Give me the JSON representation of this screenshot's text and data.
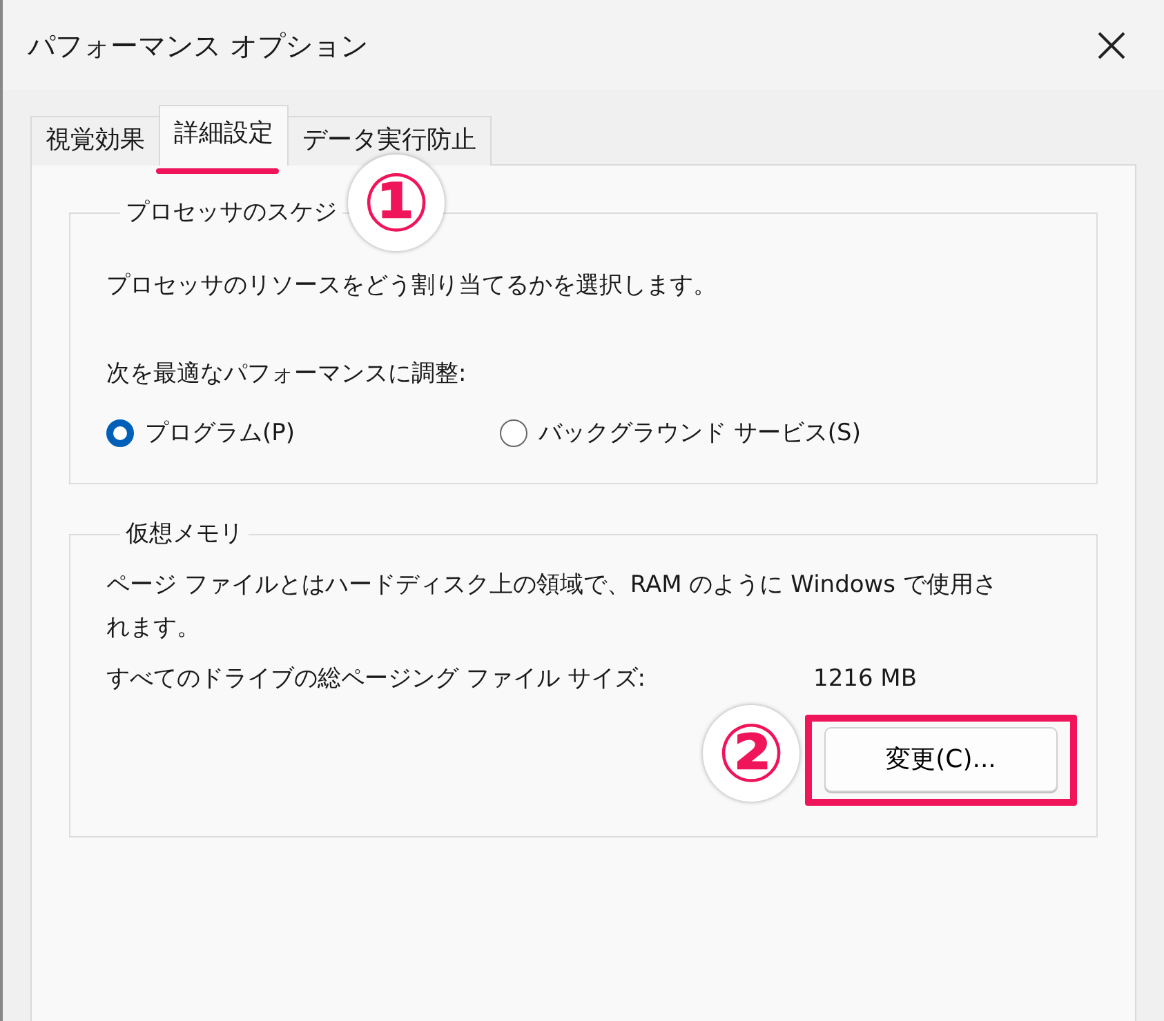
{
  "window": {
    "title": "パフォーマンス オプション"
  },
  "tabs": [
    {
      "label": "視覚効果",
      "selected": false
    },
    {
      "label": "詳細設定",
      "selected": true
    },
    {
      "label": "データ実行防止",
      "selected": false
    }
  ],
  "processor_group": {
    "title": "プロセッサのスケジ",
    "description": "プロセッサのリソースをどう割り当てるかを選択します。",
    "adjust_label": "次を最適なパフォーマンスに調整:",
    "options": [
      {
        "label": "プログラム(P)",
        "selected": true
      },
      {
        "label": "バックグラウンド サービス(S)",
        "selected": false
      }
    ]
  },
  "virtual_memory_group": {
    "title": "仮想メモリ",
    "description": "ページ ファイルとはハードディスク上の領域で、RAM のように Windows で使用されます。",
    "total_label": "すべてのドライブの総ページング ファイル サイズ:",
    "total_value": "1216 MB",
    "button": "変更(C)..."
  },
  "annotations": [
    {
      "label": "①",
      "kind": "underline"
    },
    {
      "label": "②",
      "kind": "box"
    }
  ]
}
